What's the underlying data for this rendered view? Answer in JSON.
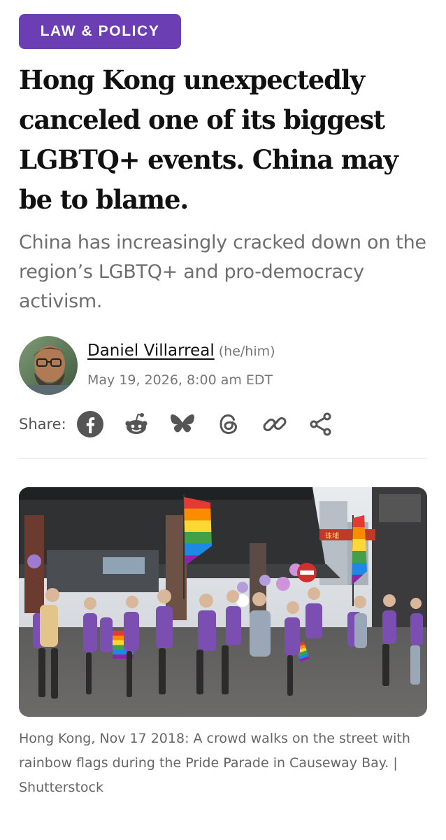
{
  "article": {
    "category": "LAW & POLICY",
    "headline": "Hong Kong unexpectedly canceled one of its biggest LGBTQ+ events. China may be to blame.",
    "dek": "China has increasingly cracked down on the region’s LGBTQ+ and pro-democracy activism."
  },
  "byline": {
    "author": "Daniel Villarreal",
    "pronouns": "(he/him)",
    "date": "May 19, 2026, 8:00 am EDT"
  },
  "share": {
    "label": "Share:",
    "buttons": [
      "facebook-icon",
      "reddit-icon",
      "bluesky-icon",
      "threads-icon",
      "link-icon",
      "share-icon"
    ]
  },
  "image": {
    "caption": "Hong Kong, Nov 17 2018: A crowd walks on the street with rainbow flags during the Pride Parade in Causeway Bay. | Shutterstock",
    "sign_text": "珠埔"
  },
  "colors": {
    "accent": "#6b3fb3",
    "headline": "#111111",
    "muted": "#6e6e6e"
  }
}
